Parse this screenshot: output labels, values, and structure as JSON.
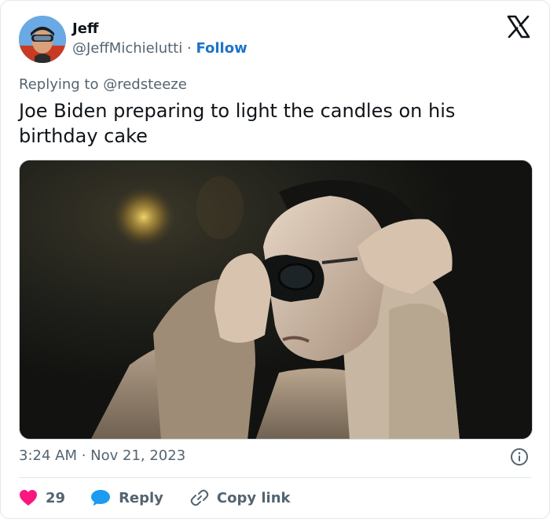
{
  "author": {
    "display_name": "Jeff",
    "handle": "@JeffMichielutti",
    "separator": "·",
    "follow_label": "Follow"
  },
  "reply_context": {
    "prefix": "Replying to",
    "mention": "@redsteeze"
  },
  "tweet": {
    "text": "Joe Biden preparing to light the candles on his birthday cake",
    "timestamp": "3:24 AM · Nov 21, 2023"
  },
  "actions": {
    "like_count": "29",
    "reply_label": "Reply",
    "copy_link_label": "Copy link"
  },
  "icons": {
    "brand": "x-logo-icon",
    "info": "info-icon",
    "like": "heart-icon",
    "reply": "speech-bubble-icon",
    "copy": "link-icon"
  },
  "colors": {
    "follow": "#1d74c8",
    "heart": "#f91880",
    "reply_bubble": "#1d9bf0",
    "muted_text": "#536471",
    "text": "#0f1419"
  }
}
